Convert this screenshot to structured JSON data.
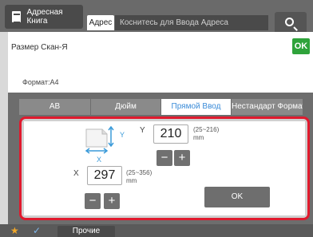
{
  "header": {
    "address_book_label": "Адресная Книга",
    "address_tab_label": "Адрес",
    "address_input_placeholder": "Коснитесь для Ввода Адреса"
  },
  "panel": {
    "title": "Размер Скан-Я",
    "ok_label": "OK",
    "format_text": "Формат:A4"
  },
  "tabs": [
    {
      "label": "AB",
      "active": false
    },
    {
      "label": "Дюйм",
      "active": false
    },
    {
      "label": "Прямой Ввод",
      "active": true
    },
    {
      "label": "Нестандарт Формат",
      "active": false
    }
  ],
  "direct_input": {
    "y_label": "Y",
    "y_value": "210",
    "y_range": "(25~216)",
    "y_unit": "mm",
    "x_label": "X",
    "x_value": "297",
    "x_range": "(25~356)",
    "x_unit": "mm",
    "minus_label": "−",
    "plus_label": "+",
    "ok_label": "OK"
  },
  "footer": {
    "other_label": "Прочие",
    "star_icon": "star-icon",
    "check_icon": "check-icon"
  },
  "colors": {
    "highlight": "#e01a2e",
    "ok_green": "#2fa33b",
    "active_tab_text": "#3a8bd8"
  }
}
